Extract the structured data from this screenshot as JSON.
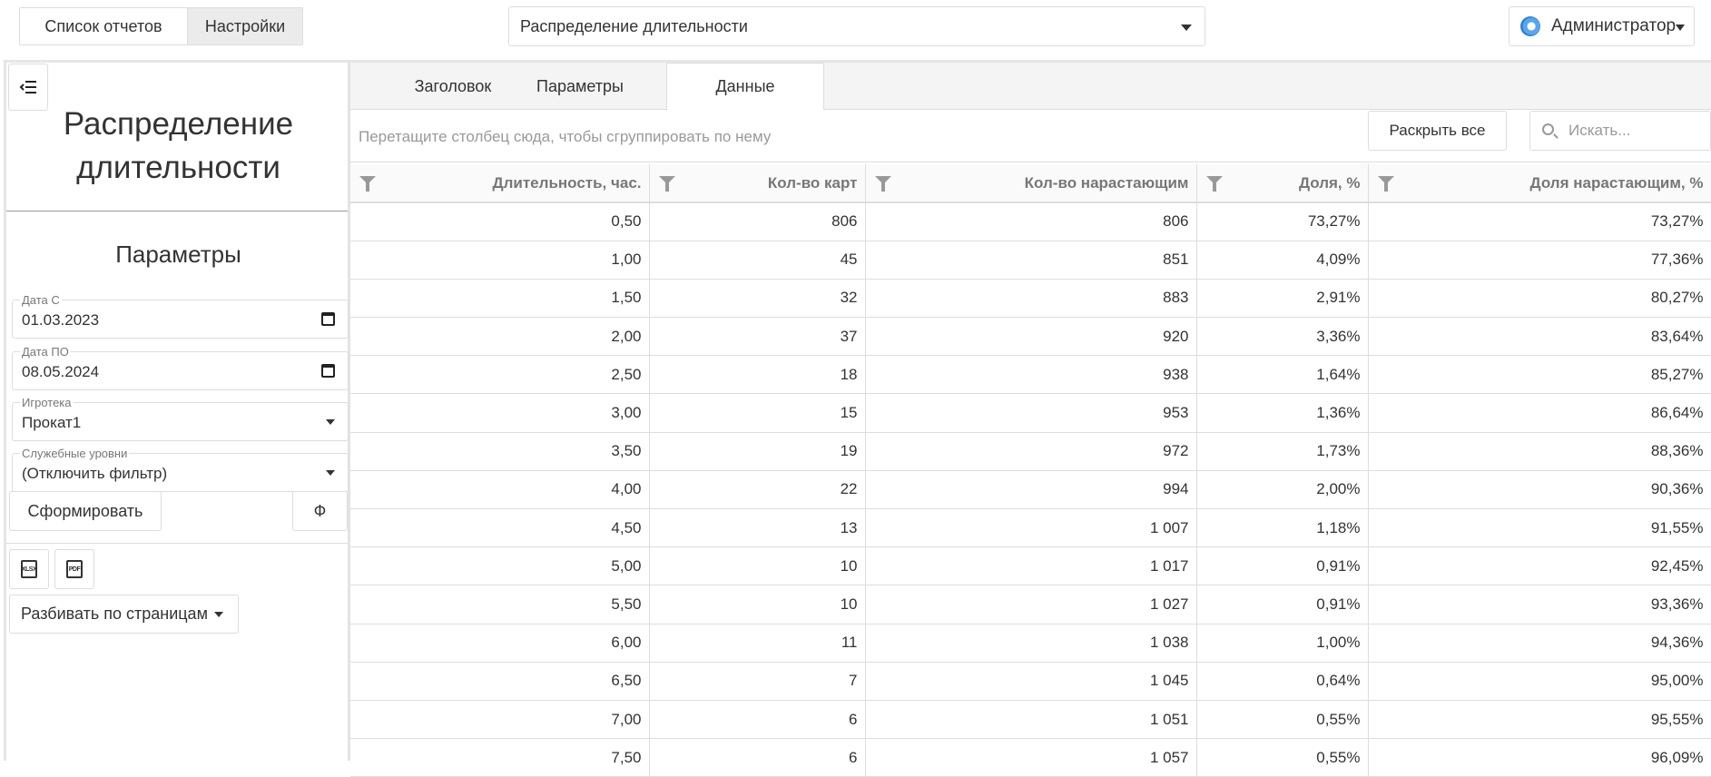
{
  "topbar": {
    "nav_buttons": [
      "Список отчетов",
      "Настройки"
    ],
    "report_select_value": "Распределение длительности",
    "user_label": "Администратор"
  },
  "left_panel": {
    "report_title": "Распределение длительности",
    "params_title": "Параметры",
    "date_from": {
      "label": "Дата С",
      "value": "01.03.2023"
    },
    "date_to": {
      "label": "Дата ПО",
      "value": "08.05.2024"
    },
    "game_room": {
      "label": "Игротека",
      "value": "Прокат1"
    },
    "service_levels": {
      "label": "Служебные уровни",
      "value": "(Отключить фильтр)"
    },
    "build_button": "Сформировать",
    "extra_button": "Ф",
    "export_xlsx_icon_text": "XLSX",
    "export_pdf_icon_text": "PDF",
    "paging_label": "Разбивать по страницам"
  },
  "tabs": [
    "Заголовок",
    "Параметры",
    "Данные"
  ],
  "active_tab": "Данные",
  "toolbar": {
    "group_hint": "Перетащите столбец сюда, чтобы сгруппировать по нему",
    "expand_all": "Раскрыть все",
    "search_placeholder": "Искать..."
  },
  "table": {
    "columns": [
      "Длительность, час.",
      "Кол-во карт",
      "Кол-во нарастающим",
      "Доля, %",
      "Доля нарастающим, %"
    ],
    "rows": [
      [
        "0,50",
        "806",
        "806",
        "73,27%",
        "73,27%"
      ],
      [
        "1,00",
        "45",
        "851",
        "4,09%",
        "77,36%"
      ],
      [
        "1,50",
        "32",
        "883",
        "2,91%",
        "80,27%"
      ],
      [
        "2,00",
        "37",
        "920",
        "3,36%",
        "83,64%"
      ],
      [
        "2,50",
        "18",
        "938",
        "1,64%",
        "85,27%"
      ],
      [
        "3,00",
        "15",
        "953",
        "1,36%",
        "86,64%"
      ],
      [
        "3,50",
        "19",
        "972",
        "1,73%",
        "88,36%"
      ],
      [
        "4,00",
        "22",
        "994",
        "2,00%",
        "90,36%"
      ],
      [
        "4,50",
        "13",
        "1 007",
        "1,18%",
        "91,55%"
      ],
      [
        "5,00",
        "10",
        "1 017",
        "0,91%",
        "92,45%"
      ],
      [
        "5,50",
        "10",
        "1 027",
        "0,91%",
        "93,36%"
      ],
      [
        "6,00",
        "11",
        "1 038",
        "1,00%",
        "94,36%"
      ],
      [
        "6,50",
        "7",
        "1 045",
        "0,64%",
        "95,00%"
      ],
      [
        "7,00",
        "6",
        "1 051",
        "0,55%",
        "95,55%"
      ],
      [
        "7,50",
        "6",
        "1 057",
        "0,55%",
        "96,09%"
      ]
    ]
  }
}
